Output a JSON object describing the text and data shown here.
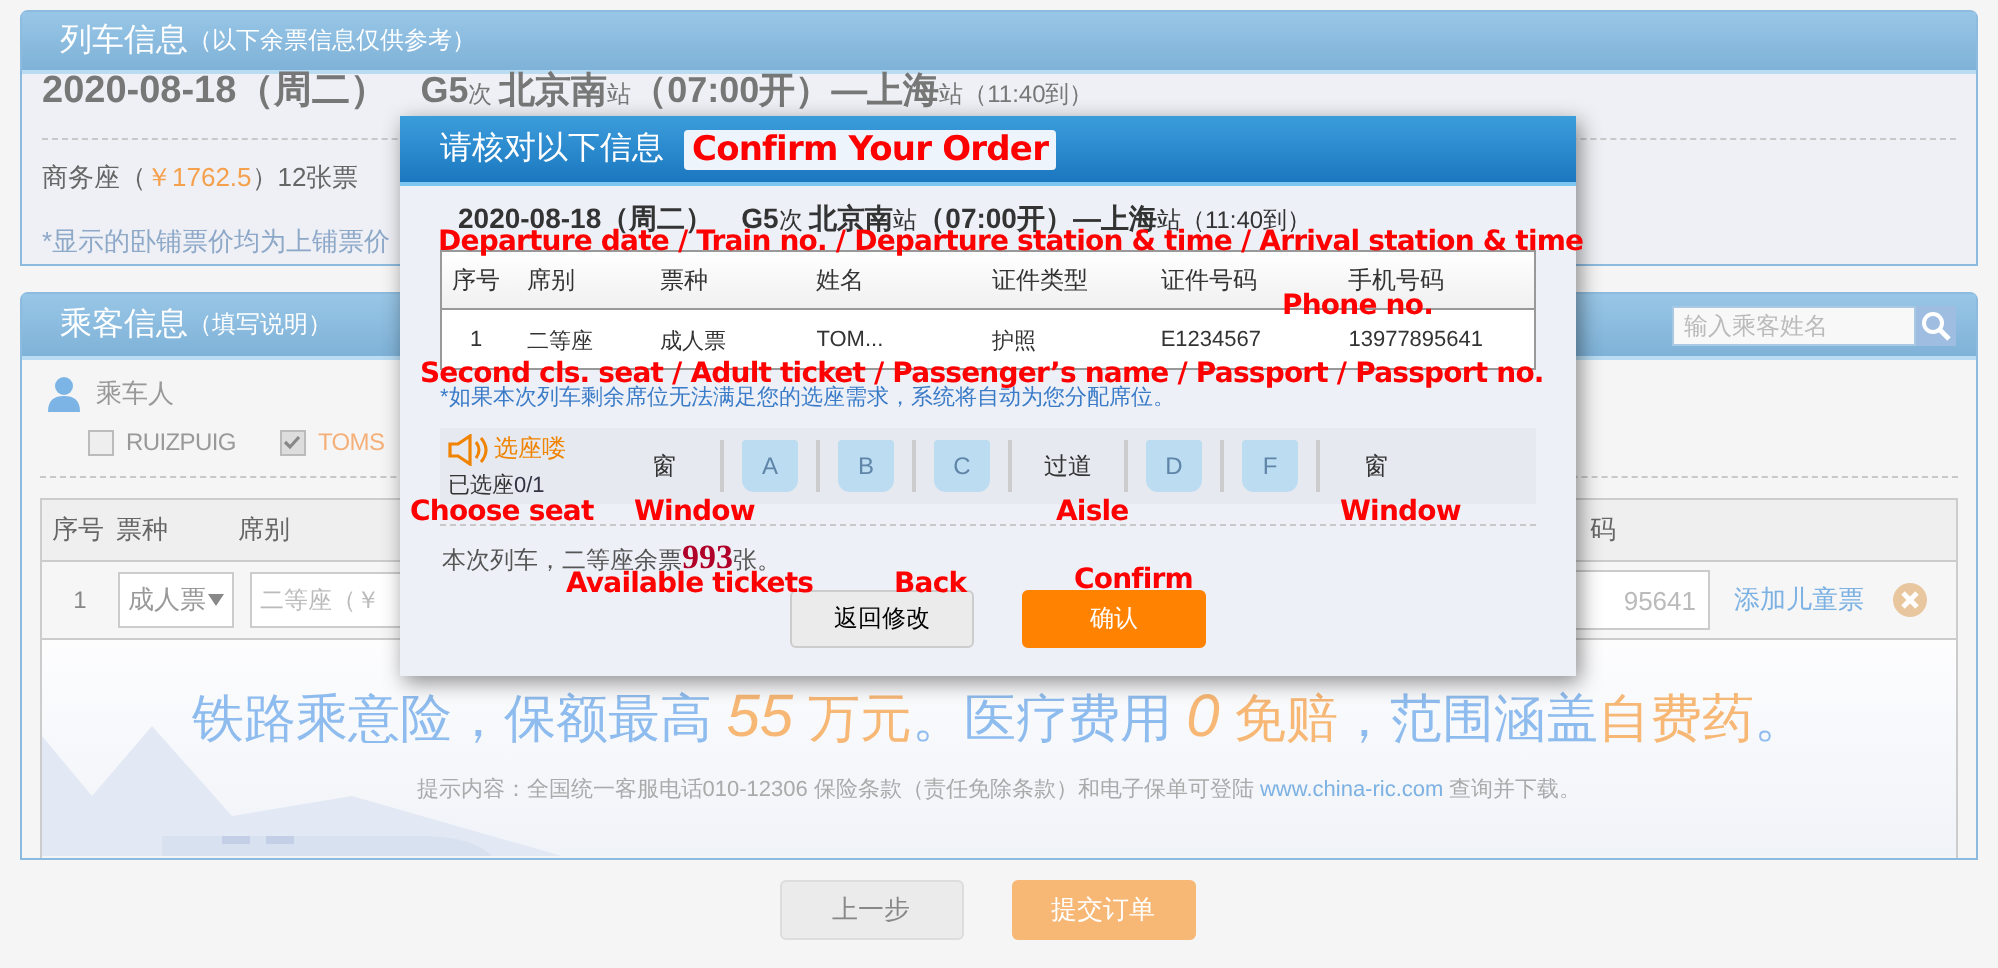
{
  "train_panel": {
    "title": "列车信息",
    "subtitle": "（以下余票信息仅供参考）",
    "date": "2020-08-18（周二）",
    "route": "**G5**次 **北京南**站**（07:00开）—上海**站（11:40到）",
    "seat_prefix": "商务座（",
    "price": "￥1762.5",
    "seat_suffix": "）12张票",
    "note": "*显示的卧铺票价均为上铺票价"
  },
  "passenger_panel": {
    "title": "乘客信息",
    "subtitle": "（填写说明）",
    "search": {
      "placeholder": "输入乘客姓名"
    },
    "riders_label": "乘车人",
    "riders": [
      {
        "name": "RUIZPUIG",
        "checked": false
      },
      {
        "name": "TOMS",
        "checked": true
      }
    ],
    "columns": [
      "序号",
      "票种",
      "席别",
      "码"
    ],
    "row": {
      "index": "1",
      "ticket_type": "成人票",
      "seat_class": "二等座（￥",
      "phone": "95641",
      "link": "添加儿童票"
    },
    "banner": {
      "segments": [
        {
          "text": "铁路乘意险，保额最高 ",
          "highlight": false
        },
        {
          "text": "*55* 万元",
          "highlight": true
        },
        {
          "text": "。医疗费用 ",
          "highlight": false
        },
        {
          "text": "*0* 免赔",
          "highlight": true
        },
        {
          "text": "，范围涵盖",
          "highlight": false
        },
        {
          "text": "自费药",
          "highlight": true
        },
        {
          "text": "。",
          "highlight": false
        }
      ],
      "hint": "提示内容：全国统一客服电话010-12306 保险条款（责任免除条款）和电子保单可登陆",
      "hint_link": "www.china-ric.com",
      "hint_end": "查询并下载。"
    }
  },
  "footer_buttons": [
    {
      "label": "上一步",
      "primary": false
    },
    {
      "label": "提交订单",
      "primary": true
    }
  ],
  "dialog": {
    "title": "请核对以下信息",
    "title_annotation": "Confirm Your Order",
    "date": "2020-08-18（周二）",
    "route": "**G5**次 **北京南**站**（07:00开）—上海**站（11:40到）",
    "columns": [
      "序号",
      "席别",
      "票种",
      "姓名",
      "证件类型",
      "证件号码",
      "手机号码"
    ],
    "row": [
      "1",
      "二等座",
      "成人票",
      "TOM...",
      "护照",
      "E1234567",
      "13977895641"
    ],
    "note": "*如果本次列车剩余席位无法满足您的选座需求，系统将自动为您分配席位。",
    "seat_title": "选座喽",
    "seat_count_label": "已选座",
    "seat_count": "0/1",
    "seat_map": [
      {
        "kind": "label",
        "text": "窗"
      },
      {
        "kind": "seat",
        "letter": "A",
        "selected": false
      },
      {
        "kind": "seat",
        "letter": "B",
        "selected": false
      },
      {
        "kind": "seat",
        "letter": "C",
        "selected": false
      },
      {
        "kind": "label",
        "text": "过道"
      },
      {
        "kind": "seat",
        "letter": "D",
        "selected": false
      },
      {
        "kind": "seat",
        "letter": "F",
        "selected": false
      },
      {
        "kind": "label",
        "text": "窗"
      }
    ],
    "remaining_prefix": "本次列车，二等座余票",
    "remaining": "993",
    "remaining_suffix": "张。",
    "buttons": [
      {
        "label": "返回修改",
        "primary": false
      },
      {
        "label": "确认",
        "primary": true
      }
    ],
    "annotations": [
      "Departure date / Train no. / Departure station & time / Arrival station & time",
      "Phone no.",
      "Second cls. seat / Adult ticket / Passenger’s name / Passport / Passport no.",
      "Choose seat",
      "Window",
      "Aisle",
      "Window",
      "Available tickets",
      "Back",
      "Confirm"
    ]
  }
}
